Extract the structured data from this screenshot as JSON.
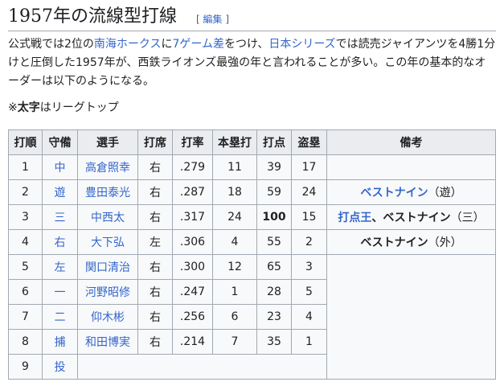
{
  "section": {
    "title": "1957年の流線型打線",
    "edit_open": "[",
    "edit_label": "編集",
    "edit_close": "]"
  },
  "paragraph": {
    "t1": "公式戦では2位の",
    "link1": "南海ホークス",
    "t2": "に",
    "link2": "7ゲーム差",
    "t3": "をつけ、",
    "link3": "日本シリーズ",
    "t4": "では読売ジャイアンツを4勝1分けと圧倒した1957年が、西鉄ライオンズ最強の年と言われることが多い。この年の基本的なオーダーは以下のようになる。"
  },
  "note": {
    "prefix": "※",
    "bold": "太字",
    "suffix": "はリーグトップ"
  },
  "table": {
    "headers": [
      "打順",
      "守備",
      "選手",
      "打席",
      "打率",
      "本塁打",
      "打点",
      "盗塁",
      "備考"
    ],
    "rows": [
      {
        "order": "1",
        "pos": "中",
        "name": "高倉照幸",
        "bat": "右",
        "avg": ".279",
        "hr": "11",
        "rbi": "39",
        "sb": "17"
      },
      {
        "order": "2",
        "pos": "遊",
        "name": "豊田泰光",
        "bat": "右",
        "avg": ".287",
        "hr": "18",
        "rbi": "59",
        "sb": "24"
      },
      {
        "order": "3",
        "pos": "三",
        "name": "中西太",
        "bat": "右",
        "avg": ".317",
        "hr": "24",
        "rbi": "100",
        "sb": "15"
      },
      {
        "order": "4",
        "pos": "右",
        "name": "大下弘",
        "bat": "左",
        "avg": ".306",
        "hr": "4",
        "rbi": "55",
        "sb": "2"
      },
      {
        "order": "5",
        "pos": "左",
        "name": "関口清治",
        "bat": "右",
        "avg": ".300",
        "hr": "12",
        "rbi": "65",
        "sb": "3"
      },
      {
        "order": "6",
        "pos": "一",
        "name": "河野昭修",
        "bat": "右",
        "avg": ".247",
        "hr": "1",
        "rbi": "28",
        "sb": "5"
      },
      {
        "order": "7",
        "pos": "二",
        "name": "仰木彬",
        "bat": "右",
        "avg": ".256",
        "hr": "6",
        "rbi": "23",
        "sb": "4"
      },
      {
        "order": "8",
        "pos": "捕",
        "name": "和田博実",
        "bat": "右",
        "avg": ".214",
        "hr": "7",
        "rbi": "35",
        "sb": "1"
      },
      {
        "order": "9",
        "pos": "投"
      }
    ],
    "remarks": {
      "r2_link": "ベストナイン",
      "r2_suffix": "（遊）",
      "r3_link": "打点王",
      "r3_mid": "、",
      "r3_link2": "ベストナイン",
      "r3_suffix": "（三）",
      "r4_link": "ベストナイン",
      "r4_suffix": "（外）"
    }
  }
}
